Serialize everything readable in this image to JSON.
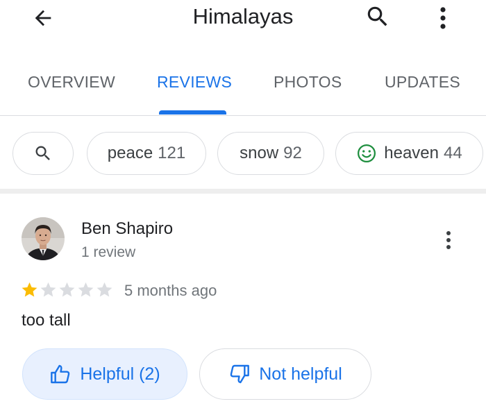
{
  "header": {
    "title": "Himalayas",
    "back_icon": "arrow-back-icon",
    "search_icon": "search-icon",
    "more_icon": "more-vert-icon"
  },
  "tabs": [
    {
      "label": "OVERVIEW",
      "active": false
    },
    {
      "label": "REVIEWS",
      "active": true
    },
    {
      "label": "PHOTOS",
      "active": false
    },
    {
      "label": "UPDATES",
      "active": false
    }
  ],
  "filter_chips": [
    {
      "label": "peace",
      "count": "121"
    },
    {
      "label": "snow",
      "count": "92"
    },
    {
      "label": "heaven",
      "count": "44",
      "icon": "smiley-icon"
    }
  ],
  "review": {
    "author": "Ben Shapiro",
    "author_meta": "1 review",
    "rating": 1,
    "max_rating": 5,
    "time": "5 months ago",
    "text": "too tall",
    "helpful_label": "Helpful (2)",
    "not_helpful_label": "Not helpful"
  },
  "colors": {
    "accent": "#1a73e8",
    "star_filled": "#fbbc04",
    "star_empty": "#dadce0",
    "smile_green": "#1e8e3e"
  }
}
